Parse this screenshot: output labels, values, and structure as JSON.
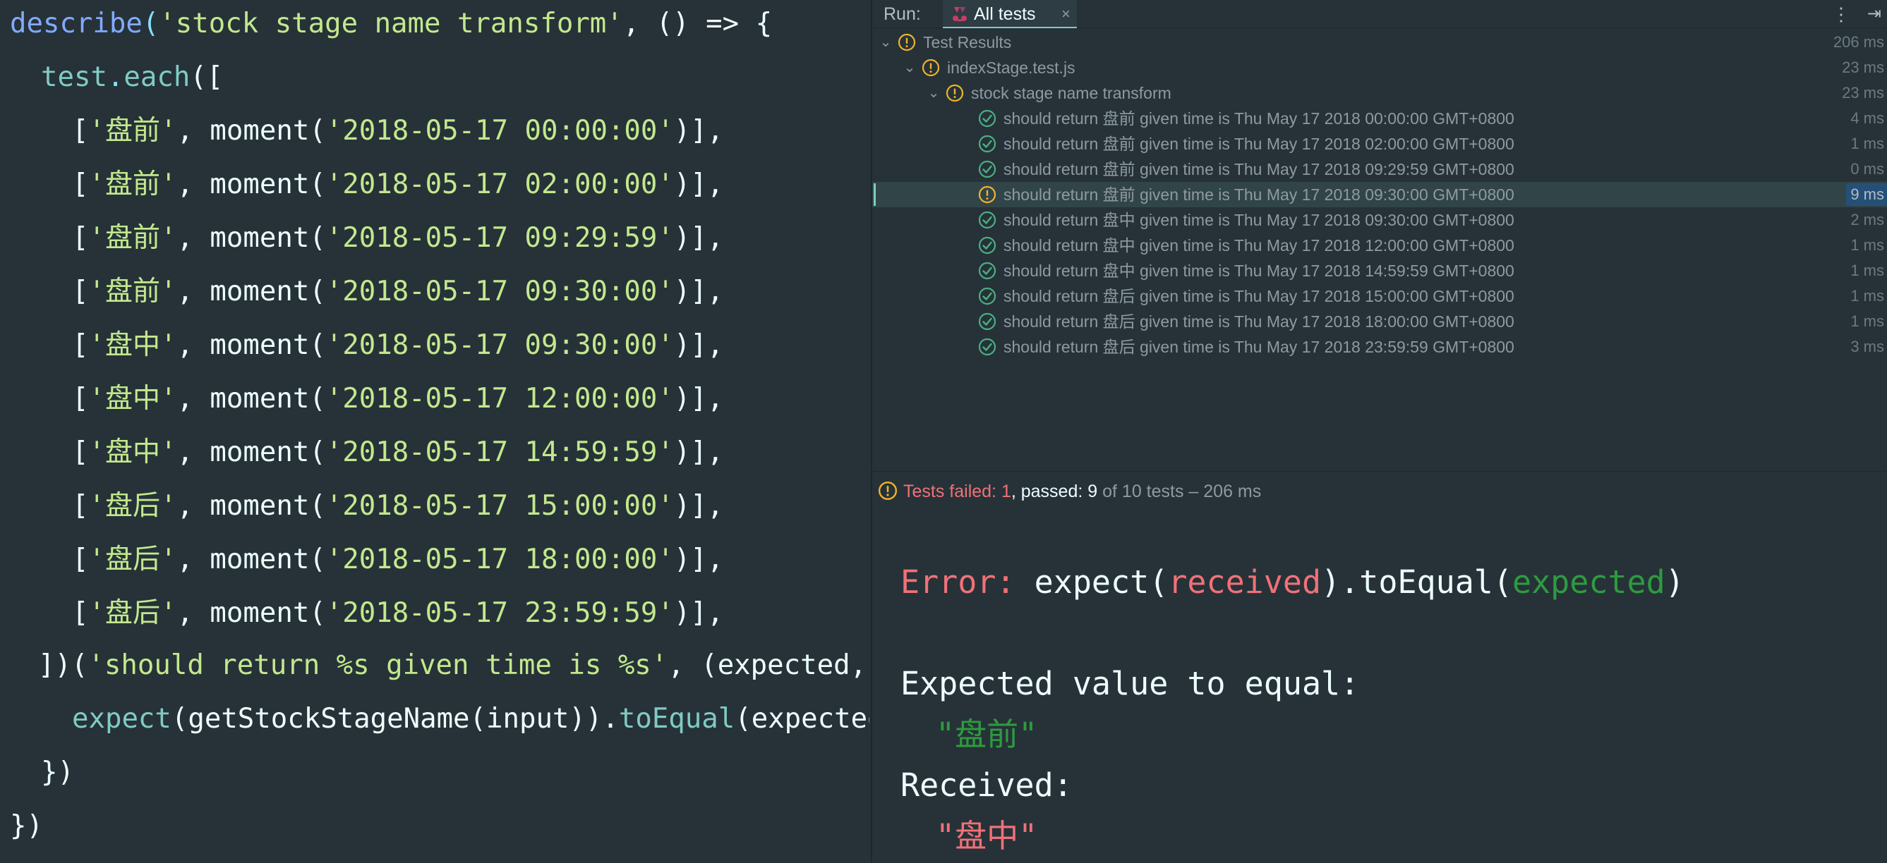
{
  "editor": {
    "line1": {
      "fn": "describe",
      "open": "(",
      "str": "'stock stage name transform'",
      "rest": ", () => {"
    },
    "line2": {
      "obj": "test",
      "dot": ".",
      "method": "each",
      "open": "(["
    },
    "rows": [
      {
        "label": "'盘前'",
        "time": "'2018-05-17 00:00:00'"
      },
      {
        "label": "'盘前'",
        "time": "'2018-05-17 02:00:00'"
      },
      {
        "label": "'盘前'",
        "time": "'2018-05-17 09:29:59'"
      },
      {
        "label": "'盘前'",
        "time": "'2018-05-17 09:30:00'"
      },
      {
        "label": "'盘中'",
        "time": "'2018-05-17 09:30:00'"
      },
      {
        "label": "'盘中'",
        "time": "'2018-05-17 12:00:00'"
      },
      {
        "label": "'盘中'",
        "time": "'2018-05-17 14:59:59'"
      },
      {
        "label": "'盘后'",
        "time": "'2018-05-17 15:00:00'"
      },
      {
        "label": "'盘后'",
        "time": "'2018-05-17 18:00:00'"
      },
      {
        "label": "'盘后'",
        "time": "'2018-05-17 23:59:59'"
      }
    ],
    "row_open": "[",
    "row_mid": ", moment(",
    "row_close": ")],",
    "line13": {
      "close": "])(",
      "str": "'should return %s given time is %s'",
      "rest": ", (expected, input) => {"
    },
    "line14": {
      "fn": "expect",
      "arg": "(getStockStageName(input)).",
      "method": "toEqual",
      "tail": "(expected)"
    },
    "line15": "})",
    "line16": "})"
  },
  "run": {
    "label": "Run:",
    "tab_label": "All tests",
    "tab_close": "×",
    "more_icon": "⋮",
    "pin_icon": "⇥"
  },
  "tree": {
    "root": {
      "label": "Test Results",
      "time": "206 ms"
    },
    "file": {
      "label": "indexStage.test.js",
      "time": "23 ms"
    },
    "suite": {
      "label": "stock stage name transform",
      "time": "23 ms"
    },
    "tests": [
      {
        "label": "should return 盘前 given time is Thu May 17 2018 00:00:00 GMT+0800",
        "time": "4 ms",
        "status": "passed"
      },
      {
        "label": "should return 盘前 given time is Thu May 17 2018 02:00:00 GMT+0800",
        "time": "1 ms",
        "status": "passed"
      },
      {
        "label": "should return 盘前 given time is Thu May 17 2018 09:29:59 GMT+0800",
        "time": "0 ms",
        "status": "passed"
      },
      {
        "label": "should return 盘前 given time is Thu May 17 2018 09:30:00 GMT+0800",
        "time": "9 ms",
        "status": "failed"
      },
      {
        "label": "should return 盘中 given time is Thu May 17 2018 09:30:00 GMT+0800",
        "time": "2 ms",
        "status": "passed"
      },
      {
        "label": "should return 盘中 given time is Thu May 17 2018 12:00:00 GMT+0800",
        "time": "1 ms",
        "status": "passed"
      },
      {
        "label": "should return 盘中 given time is Thu May 17 2018 14:59:59 GMT+0800",
        "time": "1 ms",
        "status": "passed"
      },
      {
        "label": "should return 盘后 given time is Thu May 17 2018 15:00:00 GMT+0800",
        "time": "1 ms",
        "status": "passed"
      },
      {
        "label": "should return 盘后 given time is Thu May 17 2018 18:00:00 GMT+0800",
        "time": "1 ms",
        "status": "passed"
      },
      {
        "label": "should return 盘后 given time is Thu May 17 2018 23:59:59 GMT+0800",
        "time": "3 ms",
        "status": "passed"
      }
    ]
  },
  "summary": {
    "failed": "Tests failed: 1",
    "passed": ", passed: 9",
    "rest": " of 10 tests – 206 ms"
  },
  "console": {
    "error_label": "Error:",
    "expect_pre": " expect(",
    "received_word": "received",
    "expect_mid": ").toEqual(",
    "expected_word": "expected",
    "expect_post": ")",
    "expected_heading": "Expected value to equal:",
    "expected_value": "\"盘前\"",
    "received_heading": "Received:",
    "received_value": "\"盘中\""
  },
  "colors": {
    "background": "#263238",
    "pass": "#4caf83",
    "fail": "#f0b429",
    "string": "#c3e88d",
    "function": "#82aaff",
    "error": "#f07178"
  }
}
